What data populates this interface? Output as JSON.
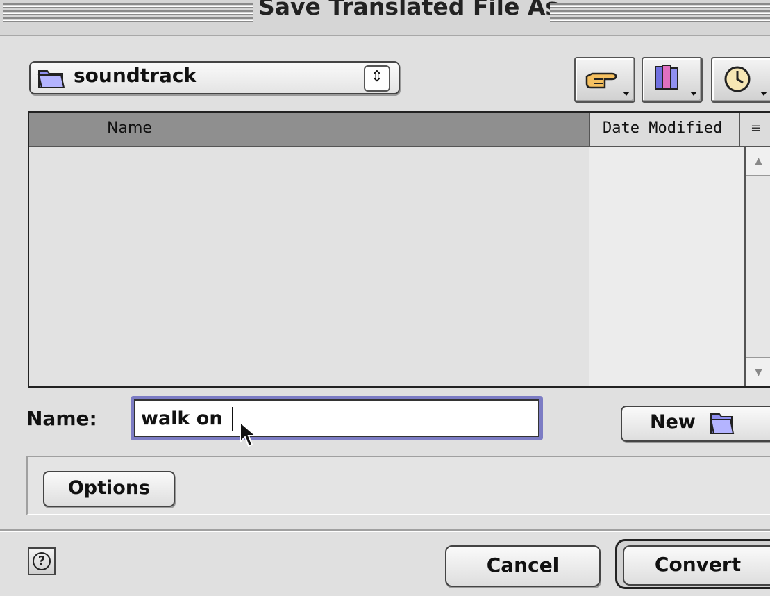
{
  "window": {
    "title": "Save Translated File As…"
  },
  "location": {
    "folder_name": "soundtrack",
    "folder_icon": "folder-icon",
    "arrows_icon": "up-down-arrows-icon"
  },
  "toolbar": {
    "buttons": [
      {
        "icon": "pointing-hand-icon"
      },
      {
        "icon": "favorites-books-icon"
      },
      {
        "icon": "recent-clock-icon"
      }
    ]
  },
  "file_list": {
    "columns": [
      "Name",
      "Date Modified"
    ],
    "sort_icon": "sort-order-icon",
    "rows": []
  },
  "save_name": {
    "label": "Name:",
    "value": "walk on"
  },
  "new_folder_button": {
    "label": "New",
    "icon": "new-folder-icon"
  },
  "options_button": {
    "label": "Options"
  },
  "help_button": {
    "icon": "help-icon",
    "glyph": "?"
  },
  "actions": {
    "cancel": "Cancel",
    "convert": "Convert"
  }
}
